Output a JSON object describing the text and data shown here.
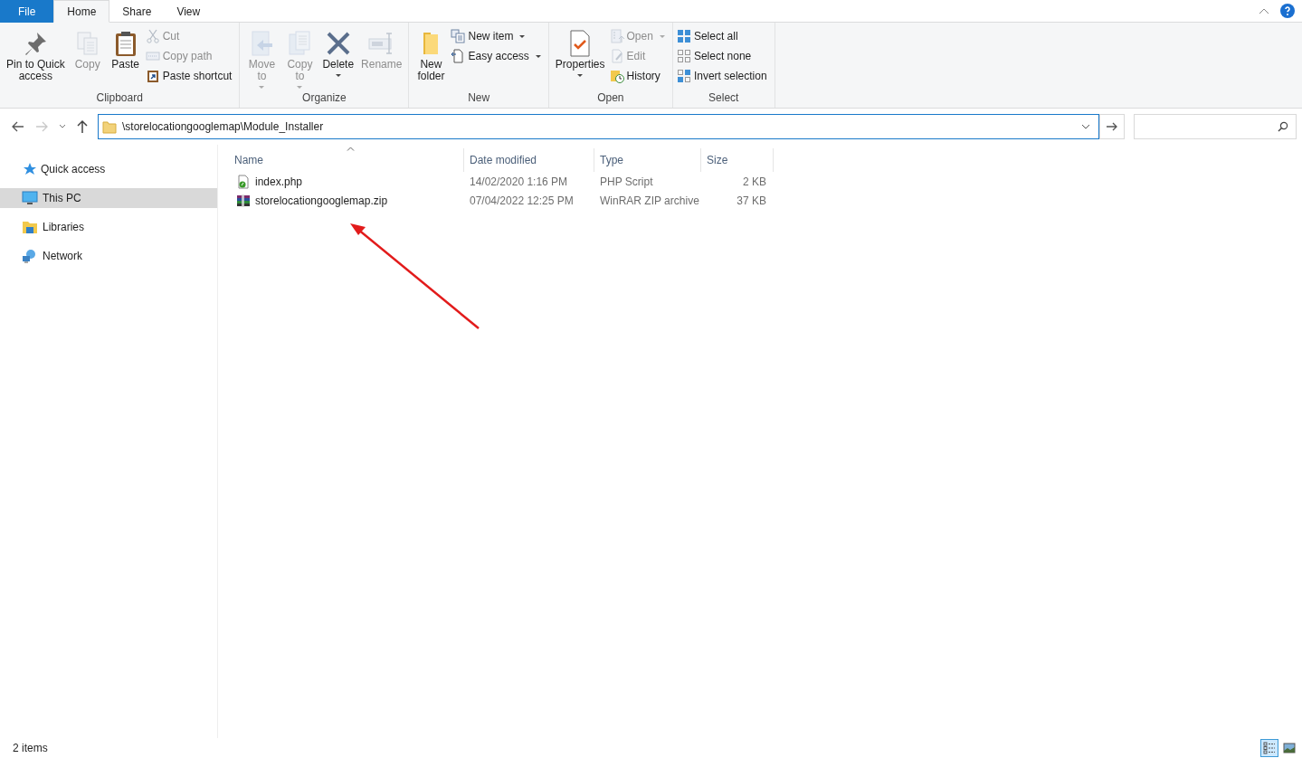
{
  "tabs": [
    {
      "label": "File",
      "kind": "file",
      "selected": false
    },
    {
      "label": "Home",
      "kind": "tab",
      "selected": true
    },
    {
      "label": "Share",
      "kind": "tab",
      "selected": false
    },
    {
      "label": "View",
      "kind": "tab",
      "selected": false
    }
  ],
  "ribbon": [
    {
      "name": "Clipboard",
      "items": [
        {
          "label": "Pin to Quick\naccess",
          "kind": "large",
          "disabled": false,
          "dropdown": false
        },
        {
          "label": "Copy",
          "kind": "large",
          "disabled": true,
          "dropdown": false
        },
        {
          "label": "Paste",
          "kind": "large",
          "disabled": false,
          "dropdown": false
        },
        {
          "label": "Cut",
          "kind": "small",
          "disabled": true,
          "dropdown": false
        },
        {
          "label": "Copy path",
          "kind": "small",
          "disabled": true,
          "dropdown": false
        },
        {
          "label": "Paste shortcut",
          "kind": "small",
          "disabled": false,
          "dropdown": false
        }
      ]
    },
    {
      "name": "Organize",
      "items": [
        {
          "label": "Move\nto",
          "kind": "large",
          "disabled": true,
          "dropdown": true
        },
        {
          "label": "Copy\nto",
          "kind": "large",
          "disabled": true,
          "dropdown": true
        },
        {
          "label": "Delete",
          "kind": "large",
          "disabled": false,
          "dropdown": true
        },
        {
          "label": "Rename",
          "kind": "large",
          "disabled": true,
          "dropdown": false
        }
      ]
    },
    {
      "name": "New",
      "items": [
        {
          "label": "New\nfolder",
          "kind": "large",
          "disabled": false,
          "dropdown": false
        },
        {
          "label": "New item",
          "kind": "small",
          "disabled": false,
          "dropdown": true
        },
        {
          "label": "Easy access",
          "kind": "small",
          "disabled": false,
          "dropdown": true
        }
      ]
    },
    {
      "name": "Open",
      "items": [
        {
          "label": "Properties",
          "kind": "large",
          "disabled": false,
          "dropdown": true
        },
        {
          "label": "Open",
          "kind": "small",
          "disabled": true,
          "dropdown": true
        },
        {
          "label": "Edit",
          "kind": "small",
          "disabled": true,
          "dropdown": false
        },
        {
          "label": "History",
          "kind": "small",
          "disabled": false,
          "dropdown": false
        }
      ]
    },
    {
      "name": "Select",
      "items": [
        {
          "label": "Select all",
          "kind": "small",
          "disabled": false,
          "dropdown": false
        },
        {
          "label": "Select none",
          "kind": "small",
          "disabled": false,
          "dropdown": false
        },
        {
          "label": "Invert selection",
          "kind": "small",
          "disabled": false,
          "dropdown": false
        }
      ]
    }
  ],
  "address": {
    "path": "\\storelocationgooglemap\\Module_Installer"
  },
  "sidebar": {
    "items": [
      {
        "label": "Quick access",
        "kind": "star",
        "selected": false
      },
      {
        "label": "This PC",
        "kind": "pc",
        "selected": true
      },
      {
        "label": "Libraries",
        "kind": "library",
        "selected": false
      },
      {
        "label": "Network",
        "kind": "network",
        "selected": false
      }
    ]
  },
  "table": {
    "columns": [
      {
        "label": "Name",
        "sorted": true
      },
      {
        "label": "Date modified",
        "sorted": false
      },
      {
        "label": "Type",
        "sorted": false
      },
      {
        "label": "Size",
        "sorted": false
      }
    ],
    "rows": [
      {
        "kind": "php",
        "name": "index.php",
        "date": "14/02/2020 1:16 PM",
        "type": "PHP Script",
        "size": "2 KB"
      },
      {
        "kind": "archive",
        "name": "storelocationgooglemap.zip",
        "date": "07/04/2022 12:25 PM",
        "type": "WinRAR ZIP archive",
        "size": "37 KB"
      }
    ]
  },
  "status_bar": {
    "text": "2 items",
    "views": [
      {
        "kind": "details",
        "selected": true
      },
      {
        "kind": "large-icons",
        "selected": false
      }
    ]
  }
}
